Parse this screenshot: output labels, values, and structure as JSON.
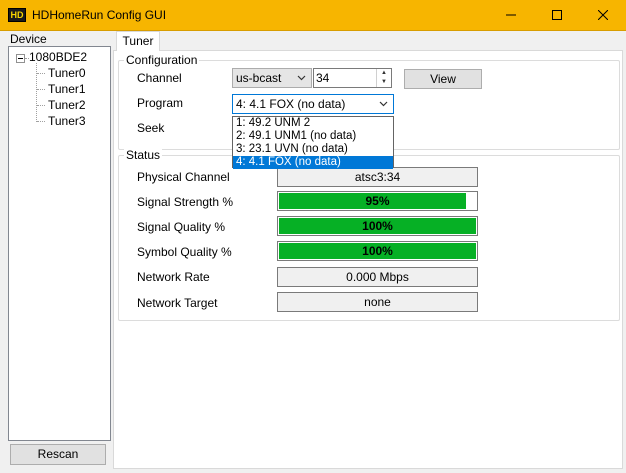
{
  "window": {
    "title": "HDHomeRun Config GUI",
    "icon_text": "HD",
    "accent_color": "#f7b500"
  },
  "sidebar": {
    "label": "Device",
    "device": "1080BDE2",
    "tuners": [
      "Tuner0",
      "Tuner1",
      "Tuner2",
      "Tuner3"
    ],
    "rescan_label": "Rescan"
  },
  "tabs": [
    {
      "label": "Tuner"
    }
  ],
  "configuration": {
    "legend": "Configuration",
    "channel_label": "Channel",
    "channel_map": "us-bcast",
    "channel_number": "34",
    "view_label": "View",
    "program_label": "Program",
    "program_selected": "4: 4.1 FOX (no data)",
    "program_options": [
      "1: 49.2 UNM 2",
      "2: 49.1 UNM1 (no data)",
      "3: 23.1 UVN (no data)",
      "4: 4.1 FOX (no data)"
    ],
    "seek_label": "Seek"
  },
  "status": {
    "legend": "Status",
    "physical_channel_label": "Physical Channel",
    "physical_channel": "atsc3:34",
    "signal_strength_label": "Signal Strength %",
    "signal_strength": "95%",
    "signal_strength_fraction": 0.95,
    "signal_quality_label": "Signal Quality %",
    "signal_quality": "100%",
    "signal_quality_fraction": 1.0,
    "symbol_quality_label": "Symbol Quality %",
    "symbol_quality": "100%",
    "symbol_quality_fraction": 1.0,
    "network_rate_label": "Network Rate",
    "network_rate": "0.000 Mbps",
    "network_target_label": "Network Target",
    "network_target": "none",
    "meter_color": "#06b025"
  }
}
